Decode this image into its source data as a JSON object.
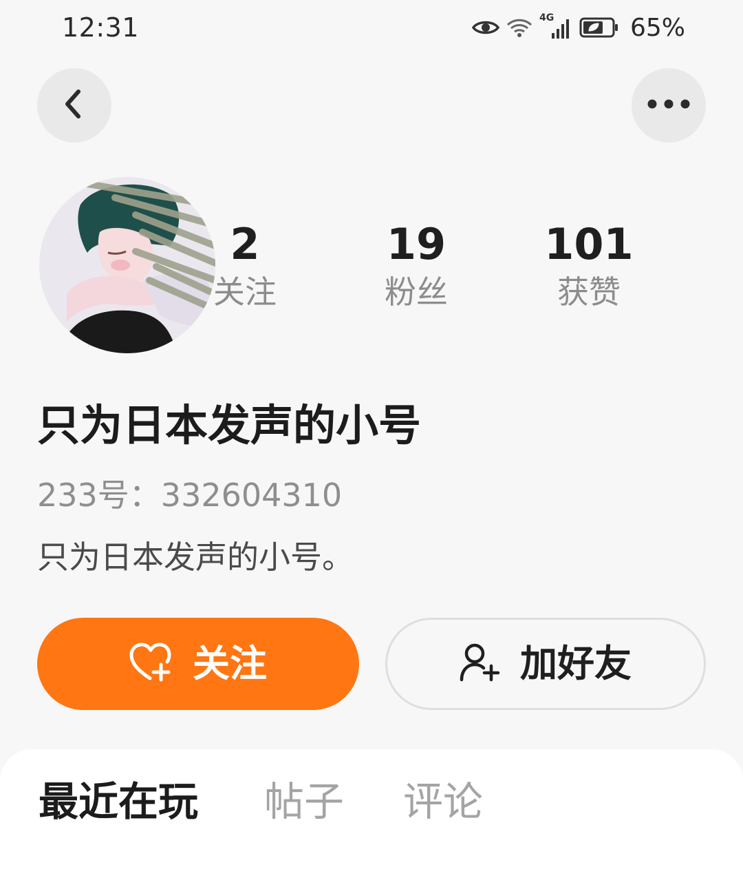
{
  "status_bar": {
    "time": "12:31",
    "network_label": "4G",
    "battery_percent": "65%",
    "icons": [
      "eye-icon",
      "wifi-icon",
      "signal-icon",
      "battery-icon"
    ]
  },
  "header": {
    "back_icon": "chevron-left-icon",
    "more_icon": "more-horizontal-icon"
  },
  "profile": {
    "stats": [
      {
        "value": "2",
        "label": "关注"
      },
      {
        "value": "19",
        "label": "粉丝"
      },
      {
        "value": "101",
        "label": "获赞"
      }
    ],
    "username": "只为日本发声的小号",
    "user_id": "233号：332604310",
    "bio": "只为日本发声的小号。"
  },
  "actions": {
    "follow_label": "关注",
    "follow_icon": "heart-plus-icon",
    "add_friend_label": "加好友",
    "add_friend_icon": "user-plus-icon"
  },
  "tabs": [
    {
      "label": "最近在玩",
      "active": true
    },
    {
      "label": "帖子",
      "active": false
    },
    {
      "label": "评论",
      "active": false
    }
  ],
  "colors": {
    "accent": "#ff7613",
    "background": "#f7f7f7"
  }
}
